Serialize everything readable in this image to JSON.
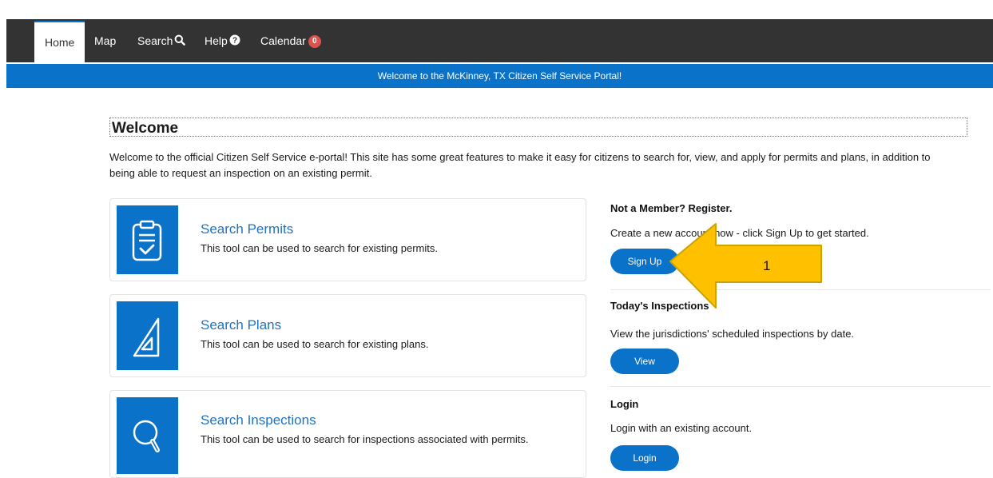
{
  "nav": {
    "items": [
      {
        "label": "Home"
      },
      {
        "label": "Map"
      },
      {
        "label": "Search"
      },
      {
        "label": "Help"
      },
      {
        "label": "Calendar",
        "badge": "0"
      }
    ]
  },
  "banner": {
    "text": "Welcome to the McKinney, TX Citizen Self Service Portal!"
  },
  "welcome": {
    "heading": "Welcome",
    "intro": "Welcome to the official Citizen Self Service e-portal! This site has some great features to make it easy for citizens to search for, view, and apply for permits and plans, in addition to being able to request an inspection on an existing permit."
  },
  "cards": [
    {
      "title": "Search Permits",
      "desc": "This tool can be used to search for existing permits."
    },
    {
      "title": "Search Plans",
      "desc": "This tool can be used to search for existing plans."
    },
    {
      "title": "Search Inspections",
      "desc": "This tool can be used to search for inspections associated with permits."
    }
  ],
  "side": {
    "register": {
      "heading": "Not a Member? Register.",
      "text": "Create a new account now - click Sign Up to get started.",
      "button": "Sign Up"
    },
    "inspections": {
      "heading": "Today's Inspections",
      "text": "View the jurisdictions' scheduled inspections by date.",
      "button": "View"
    },
    "login": {
      "heading": "Login",
      "text": "Login with an existing account.",
      "button": "Login"
    }
  },
  "annotation": {
    "label": "1",
    "fill_color": "#ffc000",
    "stroke_color": "#c9a400"
  },
  "colors": {
    "nav_bg": "#333333",
    "accent": "#0a72c9",
    "badge": "#d9534f"
  }
}
